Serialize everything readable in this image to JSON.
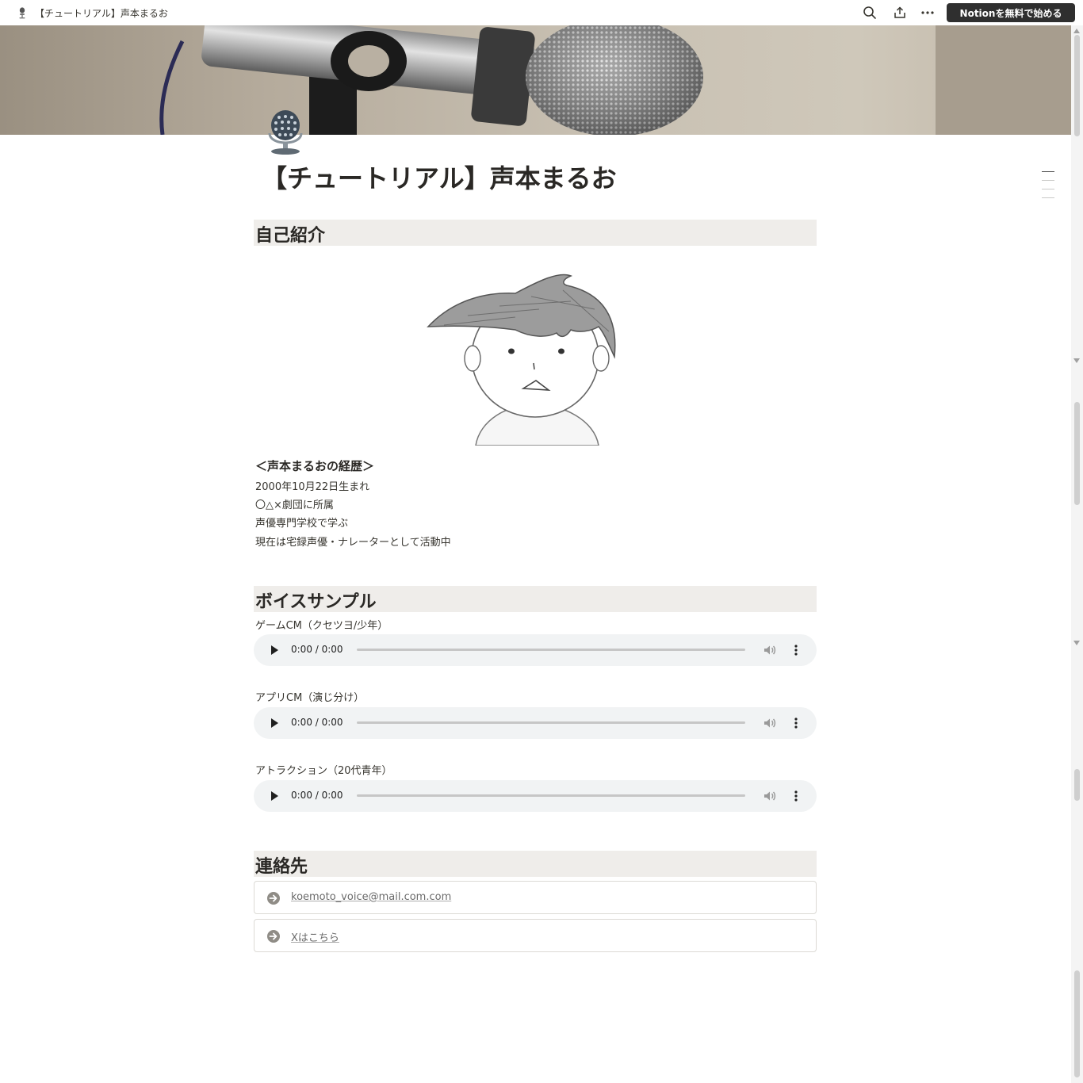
{
  "topbar": {
    "title": "【チュートリアル】声本まるお",
    "cta_label": "Notionを無料で始める",
    "page_icon": "microphone-icon",
    "icons": [
      "search-icon",
      "share-icon",
      "more-icon"
    ]
  },
  "page": {
    "title": "【チュートリアル】声本まるお",
    "emoji": "studio-microphone-icon"
  },
  "sections": {
    "intro": {
      "heading": "自己紹介"
    },
    "voice": {
      "heading": "ボイスサンプル"
    },
    "contact": {
      "heading": "連絡先"
    }
  },
  "career": {
    "title": "＜声本まるおの経歴＞",
    "lines": [
      "2000年10月22日生まれ",
      "〇△×劇団に所属",
      "声優専門学校で学ぶ",
      "現在は宅録声優・ナレーターとして活動中"
    ]
  },
  "voice_samples": [
    {
      "label": "ゲームCM（クセツヨ/少年）",
      "time": "0:00 / 0:00"
    },
    {
      "label": "アプリCM（演じ分け）",
      "time": "0:00 / 0:00"
    },
    {
      "label": "アトラクション（20代青年）",
      "time": "0:00 / 0:00"
    }
  ],
  "contacts": [
    {
      "label": "koemoto_voice@mail.com.com",
      "icon": "arrow-circle-icon"
    },
    {
      "label": "Xはこちら",
      "icon": "arrow-circle-icon"
    }
  ],
  "colors": {
    "heading_bg": "#efedea",
    "cta_bg": "#2f2f2f",
    "audio_bg": "#f1f3f4"
  }
}
